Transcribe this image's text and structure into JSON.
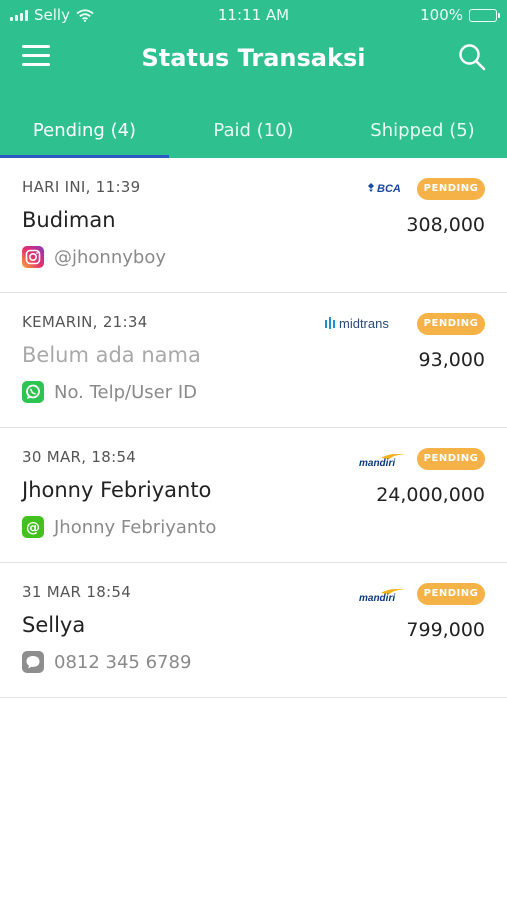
{
  "status_bar": {
    "carrier": "Selly",
    "time": "11:11 AM",
    "battery": "100%",
    "battery_level": 1.0
  },
  "header": {
    "title": "Status Transaksi",
    "menu_icon": "hamburger-menu-icon",
    "search_icon": "search-icon",
    "background_color": "#2fc08f"
  },
  "tabs": [
    {
      "label": "Pending (4)",
      "active": true
    },
    {
      "label": "Paid (10)",
      "active": false
    },
    {
      "label": "Shipped (5)",
      "active": false
    }
  ],
  "transactions": [
    {
      "date": "HARI INI, 11:39",
      "name": "Budiman",
      "name_placeholder": false,
      "contact_icon": "instagram-icon",
      "contact": "@jhonnyboy",
      "bank": "BCA",
      "bank_icon": "bca-logo",
      "status": "PENDING",
      "amount": "308,000"
    },
    {
      "date": "KEMARIN, 21:34",
      "name": "Belum ada nama",
      "name_placeholder": true,
      "contact_icon": "whatsapp-icon",
      "contact": "No. Telp/User ID",
      "bank": "midtrans",
      "bank_icon": "midtrans-logo",
      "status": "PENDING",
      "amount": "93,000"
    },
    {
      "date": "30 MAR, 18:54",
      "name": "Jhonny Febriyanto",
      "name_placeholder": false,
      "contact_icon": "line-at-icon",
      "contact": "Jhonny Febriyanto",
      "bank": "mandiri",
      "bank_icon": "mandiri-logo",
      "status": "PENDING",
      "amount": "24,000,000"
    },
    {
      "date": "31 MAR 18:54",
      "name": "Sellya",
      "name_placeholder": false,
      "contact_icon": "sms-icon",
      "contact": "0812 345 6789",
      "bank": "mandiri",
      "bank_icon": "mandiri-logo",
      "status": "PENDING",
      "amount": "799,000"
    }
  ],
  "colors": {
    "accent": "#2fc08f",
    "pending_badge": "#f5b347",
    "tab_indicator": "#2b59c3"
  }
}
